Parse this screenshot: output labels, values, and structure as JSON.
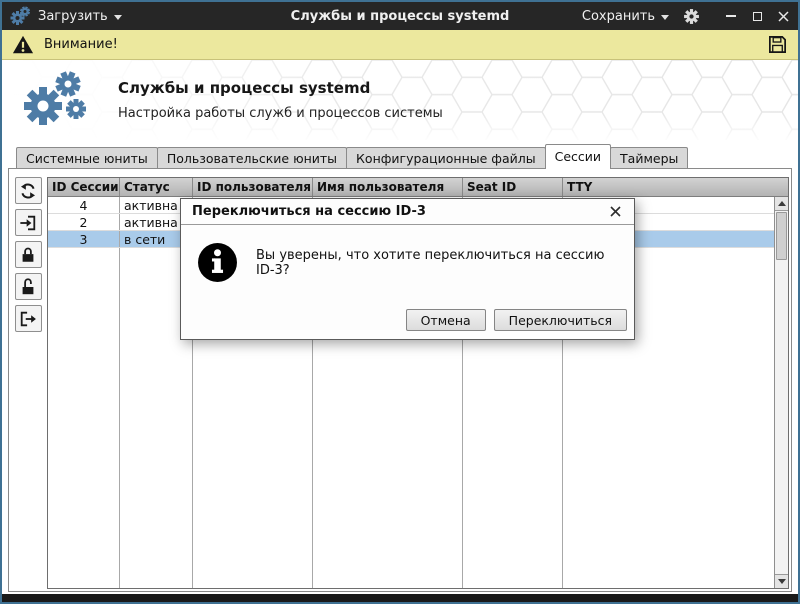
{
  "colors": {
    "window_border": "#3f7193",
    "titlebar_bg": "#262626",
    "accent_gear_blue": "#4e7ca6",
    "warning_bg": "#ece89e",
    "selection_bg": "#a9cbea"
  },
  "titlebar": {
    "load_label": "Загрузить",
    "title": "Службы и процессы systemd",
    "save_label": "Сохранить"
  },
  "warning_bar": {
    "label": "Внимание!"
  },
  "header": {
    "title": "Службы и процессы systemd",
    "subtitle": "Настройка работы служб и процессов системы"
  },
  "tabs": [
    {
      "label": "Системные юниты",
      "active": false
    },
    {
      "label": "Пользовательские юниты",
      "active": false
    },
    {
      "label": "Конфигурационные файлы",
      "active": false
    },
    {
      "label": "Сессии",
      "active": true
    },
    {
      "label": "Таймеры",
      "active": false
    }
  ],
  "toolbar": {
    "buttons": [
      {
        "icon": "refresh-icon"
      },
      {
        "icon": "switch-session-icon"
      },
      {
        "icon": "lock-icon"
      },
      {
        "icon": "unlock-icon"
      },
      {
        "icon": "terminate-session-icon"
      }
    ]
  },
  "sessions_table": {
    "columns": [
      "ID Сессии",
      "Статус",
      "ID пользователя",
      "Имя пользователя",
      "Seat ID",
      "TTY"
    ],
    "rows": [
      {
        "selected": false,
        "cells": [
          "4",
          "активна",
          "",
          "",
          "",
          ""
        ]
      },
      {
        "selected": false,
        "cells": [
          "2",
          "активна",
          "",
          "",
          "",
          ""
        ]
      },
      {
        "selected": true,
        "cells": [
          "3",
          "в сети",
          "",
          "",
          "",
          ""
        ]
      }
    ]
  },
  "dialog": {
    "title": "Переключиться на сессию ID-3",
    "message": "Вы уверены, что хотите переключиться на сессию ID-3?",
    "buttons": [
      {
        "label": "Отмена"
      },
      {
        "label": "Переключиться"
      }
    ]
  },
  "icons": {
    "app-gears-icon": "two blue gears",
    "settings-gear-icon": "gear",
    "minimize-icon": "dash",
    "maximize-icon": "square",
    "close-icon": "x",
    "warning-icon": "exclamation triangle",
    "save-file-icon": "floppy disk",
    "info-icon": "circle with letter i",
    "refresh-icon": "circular arrows",
    "switch-session-icon": "arrow into doorway",
    "lock-icon": "closed padlock",
    "unlock-icon": "open padlock",
    "terminate-session-icon": "arrow out of doorway",
    "scroll-up-icon": "triangle up",
    "scroll-down-icon": "triangle down",
    "dropdown-icon": "triangle down"
  }
}
